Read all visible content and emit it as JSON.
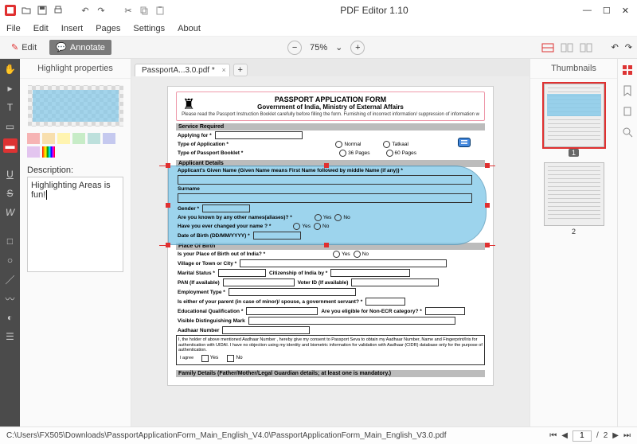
{
  "app": {
    "title": "PDF Editor 1.10"
  },
  "menu": [
    "File",
    "Edit",
    "Insert",
    "Pages",
    "Settings",
    "About"
  ],
  "modes": {
    "edit": "Edit",
    "annotate": "Annotate"
  },
  "zoom": {
    "value": "75%",
    "drop": "⌄"
  },
  "tab": {
    "label": "PassportA...3.0.pdf *"
  },
  "left_panel": {
    "title": "Highlight properties",
    "swatches": [
      "#f6b4b4",
      "#f8dfae",
      "#fff4b0",
      "#c7ecc7",
      "#bde0dc",
      "#c5c9ef",
      "#e3c5ef"
    ],
    "desc_label": "Description:",
    "desc_value": "Highlighting Areas is fun!"
  },
  "thumbs": {
    "title": "Thumbnails",
    "pages": [
      "1",
      "2"
    ]
  },
  "status": {
    "path": "C:\\Users\\FX505\\Downloads\\PassportApplicationForm_Main_English_V4.0\\PassportApplicationForm_Main_English_V3.0.pdf",
    "page": "1",
    "total": "2"
  },
  "form": {
    "title": "PASSPORT APPLICATION FORM",
    "subtitle": "Government of India, Ministry of External Affairs",
    "note": "Please read the Passport Instruction Booklet carefully before filling the form. Furnishing of incorrect information/ suppression of information w",
    "s_service": "Service Required",
    "applying_for": "Applying for *",
    "type_app": "Type of Application *",
    "normal": "Normal",
    "tatkaal": "Tatkaal",
    "type_booklet": "Type of Passport Booklet *",
    "p36": "36 Pages",
    "p60": "60 Pages",
    "s_applicant": "Applicant Details",
    "given_name": "Applicant's Given Name (Given Name means First Name followed by middle Name (if any)) *",
    "surname": "Surname",
    "gender": "Gender *",
    "aliases": "Are you known by any other names(aliases)? *",
    "changed": "Have you ever changed your name ? *",
    "dob": "Date of Birth (DD/MM/YYYY) *",
    "yes": "Yes",
    "no": "No",
    "s_pob": "Place Of Birth",
    "pob_out": "Is your Place of Birth out of India? *",
    "village": "Village or Town or City *",
    "marital": "Marital Status *",
    "citizen": "Citizenship of India by *",
    "pan": "PAN (If available)",
    "voter": "Voter ID (If available)",
    "emp": "Employment Type *",
    "parent_gov": "Is either of your parent (in case of minor)/ spouse, a government servant? *",
    "edu": "Educational Qualification *",
    "non_ecr": "Are you eligible for Non-ECR category? *",
    "dist_mark": "Visible Distinguishing Mark",
    "aadhaar": "Aadhaar Number",
    "aadhaar_note": "I, the holder of above mentioned Aadhaar Number , hereby give my consent to Passport Seva to obtain my Aadhaar Number, Name and Fingerprint/Iris for authentication with UIDAI. I have no objection using my identity and biometric information for validation with Aadhaar (CIDR) database only for the purpose of authentication.",
    "agree": "I agree",
    "s_family": "Family Details (Father/Mother/Legal Guardian details; at least one is mandatory.)"
  }
}
